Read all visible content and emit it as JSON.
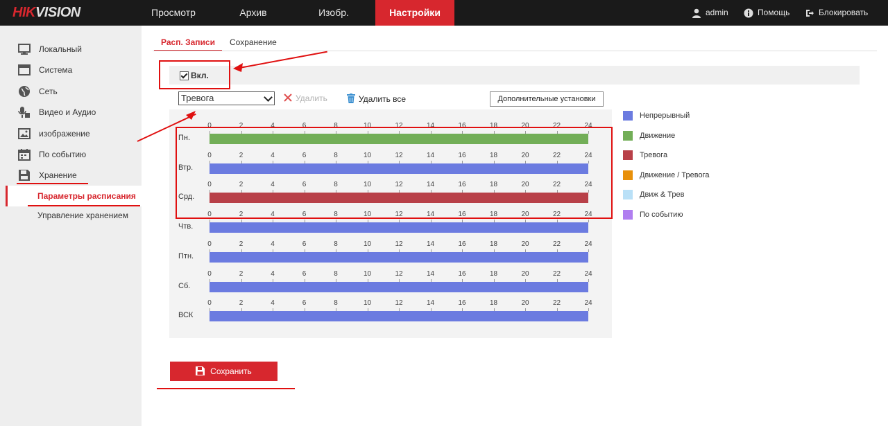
{
  "brand": {
    "logo_red": "HIK",
    "logo_rest": "VISION"
  },
  "nav": {
    "items": [
      {
        "label": "Просмотр"
      },
      {
        "label": "Архив"
      },
      {
        "label": "Изобр."
      },
      {
        "label": "Настройки",
        "active": true
      }
    ],
    "user": "admin",
    "help": "Помощь",
    "lock": "Блокировать"
  },
  "sidebar": {
    "items": [
      {
        "label": "Локальный",
        "icon": "monitor-icon"
      },
      {
        "label": "Система",
        "icon": "system-icon"
      },
      {
        "label": "Сеть",
        "icon": "globe-icon"
      },
      {
        "label": "Видео и Аудио",
        "icon": "mic-camera-icon"
      },
      {
        "label": "изображение",
        "icon": "image-icon"
      },
      {
        "label": "По событию",
        "icon": "calendar-icon"
      },
      {
        "label": "Хранение",
        "icon": "storage-icon"
      }
    ],
    "sub_items": [
      {
        "label": "Параметры расписания",
        "active": true
      },
      {
        "label": "Управление хранением"
      }
    ]
  },
  "tabs": [
    {
      "label": "Расп. Записи",
      "active": true
    },
    {
      "label": "Сохранение"
    }
  ],
  "enable": {
    "label": "Вкл.",
    "checked": true
  },
  "record_type": {
    "selected": "Тревога"
  },
  "actions": {
    "delete": "Удалить",
    "delete_all": "Удалить все",
    "advanced": "Дополнительные установки"
  },
  "schedule": {
    "hours": [
      "0",
      "2",
      "4",
      "6",
      "8",
      "10",
      "12",
      "14",
      "16",
      "18",
      "20",
      "22",
      "24"
    ],
    "days": [
      {
        "label": "Пн.",
        "mode": "Движение"
      },
      {
        "label": "Втр.",
        "mode": "Непрерывный"
      },
      {
        "label": "Срд.",
        "mode": "Тревога"
      },
      {
        "label": "Чтв.",
        "mode": "Непрерывный"
      },
      {
        "label": "Птн.",
        "mode": "Непрерывный"
      },
      {
        "label": "Сб.",
        "mode": "Непрерывный"
      },
      {
        "label": "ВСК",
        "mode": "Непрерывный"
      }
    ]
  },
  "legend": [
    {
      "label": "Непрерывный",
      "color": "#6b7be0"
    },
    {
      "label": "Движение",
      "color": "#72ae57"
    },
    {
      "label": "Тревога",
      "color": "#b84048"
    },
    {
      "label": "Движение / Тревога",
      "color": "#e8900a"
    },
    {
      "label": "Движ & Трев",
      "color": "#b9e0f7"
    },
    {
      "label": "По событию",
      "color": "#b07ef0"
    }
  ],
  "save": {
    "label": "Сохранить"
  },
  "colors": {
    "accent": "#d7272e",
    "annotation": "#e01010"
  }
}
